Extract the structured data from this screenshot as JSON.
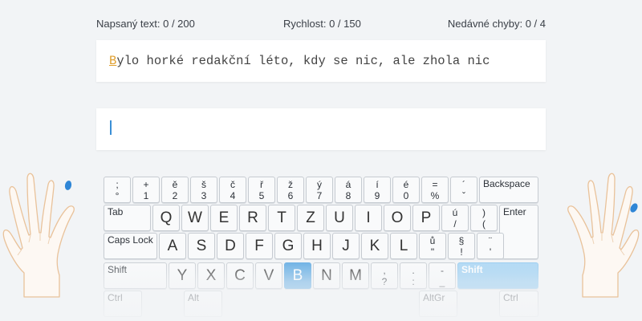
{
  "stats": {
    "typed": "Napsaný text: 0 / 200",
    "speed": "Rychlost: 0 / 150",
    "errors": "Nedávné chyby: 0 / 4"
  },
  "text": {
    "current_char": "B",
    "rest": "ylo horké redakční léto, kdy se nic, ale zhola nic"
  },
  "input": {
    "value": ""
  },
  "colors": {
    "accent": "#5ba8e2",
    "cursor_char": "#e0a030",
    "caret": "#3a8fd6",
    "finger_marker": "#2f86d6"
  },
  "keyboard": {
    "row1": [
      {
        "top": ";",
        "bottom": "°"
      },
      {
        "top": "+",
        "bottom": "1"
      },
      {
        "top": "ě",
        "bottom": "2"
      },
      {
        "top": "š",
        "bottom": "3"
      },
      {
        "top": "č",
        "bottom": "4"
      },
      {
        "top": "ř",
        "bottom": "5"
      },
      {
        "top": "ž",
        "bottom": "6"
      },
      {
        "top": "ý",
        "bottom": "7"
      },
      {
        "top": "á",
        "bottom": "8"
      },
      {
        "top": "í",
        "bottom": "9"
      },
      {
        "top": "é",
        "bottom": "0"
      },
      {
        "top": "=",
        "bottom": "%"
      },
      {
        "top": "´",
        "bottom": "ˇ"
      }
    ],
    "backspace": "Backspace",
    "tab": "Tab",
    "row2": [
      "Q",
      "W",
      "E",
      "R",
      "T",
      "Z",
      "U",
      "I",
      "O",
      "P"
    ],
    "row2_extra": [
      {
        "top": "ú",
        "bottom": "/"
      },
      {
        "top": ")",
        "bottom": "("
      }
    ],
    "enter": "Enter",
    "caps": "Caps Lock",
    "row3": [
      "A",
      "S",
      "D",
      "F",
      "G",
      "H",
      "J",
      "K",
      "L"
    ],
    "row3_extra": [
      {
        "top": "ů",
        "bottom": "\""
      },
      {
        "top": "§",
        "bottom": "!"
      },
      {
        "top": "¨",
        "bottom": "'"
      }
    ],
    "shift_left": "Shift",
    "row4": [
      "Y",
      "X",
      "C",
      "V",
      "B",
      "N",
      "M"
    ],
    "row4_extra": [
      {
        "top": ",",
        "bottom": "?"
      },
      {
        "top": ".",
        "bottom": ":"
      },
      {
        "top": "-",
        "bottom": "_"
      }
    ],
    "shift_right": "Shift",
    "active_key": "B",
    "bottom_row": [
      "Ctrl",
      "Alt",
      "AltGr",
      "Ctrl"
    ]
  }
}
